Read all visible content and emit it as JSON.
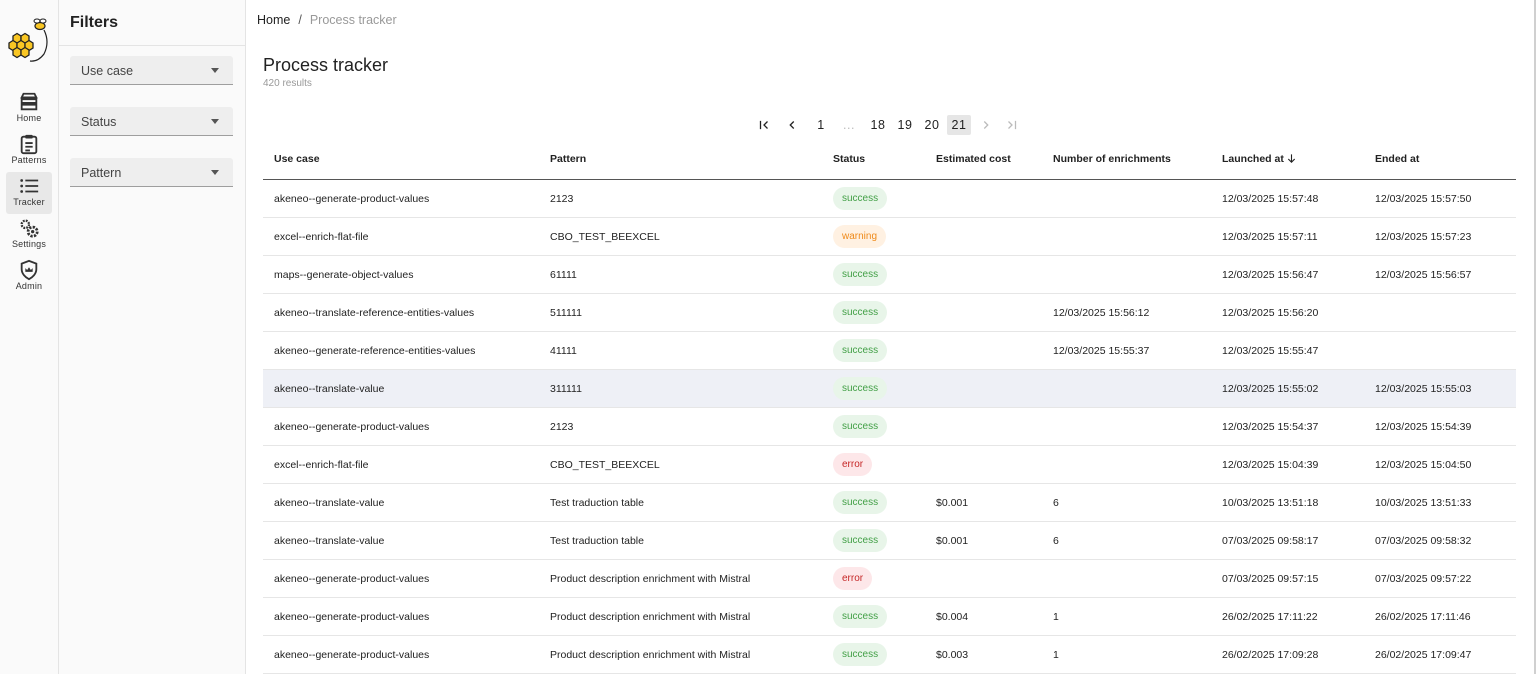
{
  "nav": {
    "items": [
      {
        "label": "Home",
        "icon": "home-stack-icon",
        "active": false
      },
      {
        "label": "Patterns",
        "icon": "clipboard-icon",
        "active": false
      },
      {
        "label": "Tracker",
        "icon": "list-icon",
        "active": true
      },
      {
        "label": "Settings",
        "icon": "gears-icon",
        "active": false
      },
      {
        "label": "Admin",
        "icon": "shield-icon",
        "active": false
      }
    ]
  },
  "filters": {
    "title": "Filters",
    "selects": [
      {
        "label": "Use case"
      },
      {
        "label": "Status"
      },
      {
        "label": "Pattern"
      }
    ]
  },
  "breadcrumb": {
    "home": "Home",
    "separator": "/",
    "current": "Process tracker"
  },
  "page": {
    "title": "Process tracker",
    "results": "420 results"
  },
  "pagination": {
    "first": "1",
    "ellipsis": "...",
    "pages": [
      "18",
      "19",
      "20",
      "21"
    ],
    "current": "21"
  },
  "table": {
    "columns": [
      "Use case",
      "Pattern",
      "Status",
      "Estimated cost",
      "Number of enrichments",
      "Launched at",
      "Ended at"
    ],
    "rows": [
      {
        "use_case": "akeneo--generate-product-values",
        "pattern": "2123",
        "status": "success",
        "cost": "",
        "enrichments": "",
        "launched": "12/03/2025 15:57:48",
        "ended": "12/03/2025 15:57:50"
      },
      {
        "use_case": "excel--enrich-flat-file",
        "pattern": "CBO_TEST_BEEXCEL",
        "status": "warning",
        "cost": "",
        "enrichments": "",
        "launched": "12/03/2025 15:57:11",
        "ended": "12/03/2025 15:57:23"
      },
      {
        "use_case": "maps--generate-object-values",
        "pattern": "61111",
        "status": "success",
        "cost": "",
        "enrichments": "",
        "launched": "12/03/2025 15:56:47",
        "ended": "12/03/2025 15:56:57"
      },
      {
        "use_case": "akeneo--translate-reference-entities-values",
        "pattern": "511111",
        "status": "success",
        "cost": "",
        "enrichments": "12/03/2025 15:56:12",
        "launched": "12/03/2025 15:56:20",
        "ended": ""
      },
      {
        "use_case": "akeneo--generate-reference-entities-values",
        "pattern": "41111",
        "status": "success",
        "cost": "",
        "enrichments": "12/03/2025 15:55:37",
        "launched": "12/03/2025 15:55:47",
        "ended": ""
      },
      {
        "use_case": "akeneo--translate-value",
        "pattern": "311111",
        "status": "success",
        "cost": "",
        "enrichments": "",
        "launched": "12/03/2025 15:55:02",
        "ended": "12/03/2025 15:55:03"
      },
      {
        "use_case": "akeneo--generate-product-values",
        "pattern": "2123",
        "status": "success",
        "cost": "",
        "enrichments": "",
        "launched": "12/03/2025 15:54:37",
        "ended": "12/03/2025 15:54:39"
      },
      {
        "use_case": "excel--enrich-flat-file",
        "pattern": "CBO_TEST_BEEXCEL",
        "status": "error",
        "cost": "",
        "enrichments": "",
        "launched": "12/03/2025 15:04:39",
        "ended": "12/03/2025 15:04:50"
      },
      {
        "use_case": "akeneo--translate-value",
        "pattern": "Test traduction table",
        "status": "success",
        "cost": "$0.001",
        "enrichments": "6",
        "launched": "10/03/2025 13:51:18",
        "ended": "10/03/2025 13:51:33"
      },
      {
        "use_case": "akeneo--translate-value",
        "pattern": "Test traduction table",
        "status": "success",
        "cost": "$0.001",
        "enrichments": "6",
        "launched": "07/03/2025 09:58:17",
        "ended": "07/03/2025 09:58:32"
      },
      {
        "use_case": "akeneo--generate-product-values",
        "pattern": "Product description enrichment with Mistral",
        "status": "error",
        "cost": "",
        "enrichments": "",
        "launched": "07/03/2025 09:57:15",
        "ended": "07/03/2025 09:57:22"
      },
      {
        "use_case": "akeneo--generate-product-values",
        "pattern": "Product description enrichment with Mistral",
        "status": "success",
        "cost": "$0.004",
        "enrichments": "1",
        "launched": "26/02/2025 17:11:22",
        "ended": "26/02/2025 17:11:46"
      },
      {
        "use_case": "akeneo--generate-product-values",
        "pattern": "Product description enrichment with Mistral",
        "status": "success",
        "cost": "$0.003",
        "enrichments": "1",
        "launched": "26/02/2025 17:09:28",
        "ended": "26/02/2025 17:09:47"
      }
    ]
  },
  "colors": {
    "success": "#43a047",
    "warning": "#ef8a1a",
    "error": "#c62828",
    "highlight_row": "#eef0f6"
  }
}
